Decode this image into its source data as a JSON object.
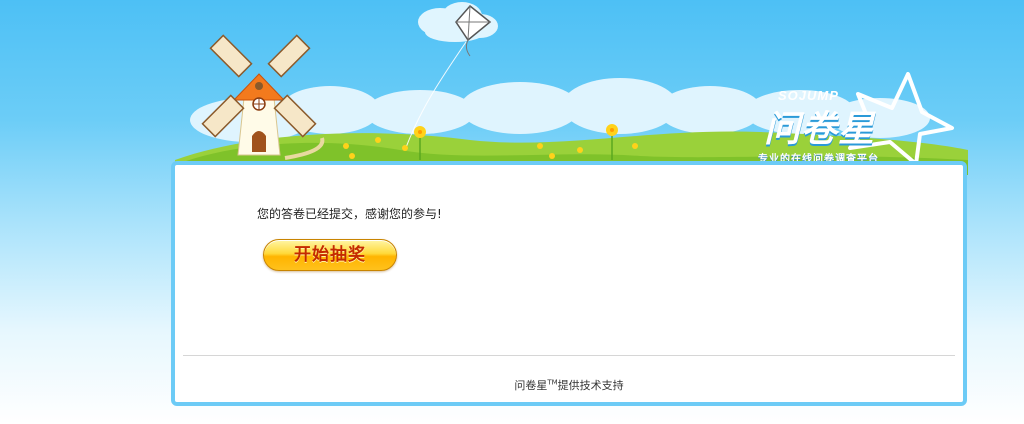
{
  "brand": {
    "logo_sub": "SOJUMP",
    "logo_main": "问卷星",
    "tagline": "专业的在线问卷调查平台"
  },
  "content": {
    "message": "您的答卷已经提交，感谢您的参与!",
    "lottery_button_label": "开始抽奖"
  },
  "footer": {
    "brand_name": "问卷星",
    "trademark": "TM",
    "credit_suffix": "提供技术支持"
  },
  "colors": {
    "sky_top": "#4dc0f5",
    "panel_border": "#6ccbf6",
    "button_text": "#c42a00",
    "button_fill": "#ffc11c"
  }
}
